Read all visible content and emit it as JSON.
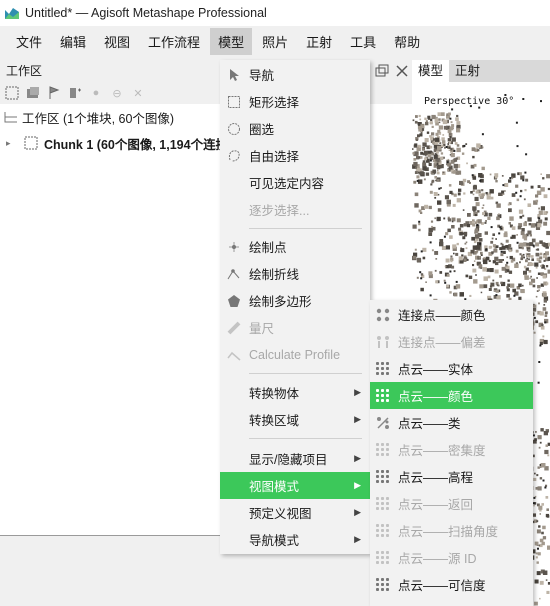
{
  "window": {
    "title": "Untitled* — Agisoft Metashape Professional",
    "accent": "#3cc85a"
  },
  "menubar": [
    "文件",
    "编辑",
    "视图",
    "工作流程",
    "模型",
    "照片",
    "正射",
    "工具",
    "帮助"
  ],
  "workspace": {
    "header": "工作区",
    "root_label": "工作区 (1个堆块, 60个图像)",
    "chunk_label": "Chunk 1 (60个图像, 1,194个连接点)"
  },
  "viewport": {
    "tabs": [
      "模型",
      "正射"
    ],
    "overlay_label": "Perspective 30°"
  },
  "model_menu": [
    {
      "label": "导航",
      "icon": "cursor-arrow-icon",
      "enabled": true
    },
    {
      "label": "矩形选择",
      "icon": "rectangle-select-icon",
      "enabled": true
    },
    {
      "label": "圈选",
      "icon": "circle-select-icon",
      "enabled": true
    },
    {
      "label": "自由选择",
      "icon": "free-select-icon",
      "enabled": true
    },
    {
      "label": "可见选定内容",
      "enabled": true
    },
    {
      "label": "逐步选择...",
      "enabled": false
    },
    {
      "label": "绘制点",
      "icon": "draw-point-icon",
      "enabled": true
    },
    {
      "label": "绘制折线",
      "icon": "draw-polyline-icon",
      "enabled": true
    },
    {
      "label": "绘制多边形",
      "icon": "draw-polygon-icon",
      "enabled": true
    },
    {
      "label": "量尺",
      "icon": "ruler-icon",
      "enabled": false
    },
    {
      "label": "Calculate Profile",
      "icon": "profile-icon",
      "enabled": false
    },
    {
      "label": "转换物体",
      "submenu": true,
      "enabled": true
    },
    {
      "label": "转换区域",
      "submenu": true,
      "enabled": true
    },
    {
      "label": "显示/隐藏项目",
      "submenu": true,
      "enabled": true
    },
    {
      "label": "视图模式",
      "submenu": true,
      "enabled": true,
      "highlighted": true
    },
    {
      "label": "预定义视图",
      "submenu": true,
      "enabled": true
    },
    {
      "label": "导航模式",
      "submenu": true,
      "enabled": true
    }
  ],
  "view_mode_menu": [
    {
      "label": "连接点——颜色",
      "enabled": true
    },
    {
      "label": "连接点——偏差",
      "enabled": false
    },
    {
      "label": "点云——实体",
      "enabled": true
    },
    {
      "label": "点云——颜色",
      "enabled": true,
      "highlighted": true
    },
    {
      "label": "点云——类",
      "enabled": true
    },
    {
      "label": "点云——密集度",
      "enabled": false
    },
    {
      "label": "点云——高程",
      "enabled": true
    },
    {
      "label": "点云——返回",
      "enabled": false
    },
    {
      "label": "点云——扫描角度",
      "enabled": false
    },
    {
      "label": "点云——源 ID",
      "enabled": false
    },
    {
      "label": "点云——可信度",
      "enabled": true
    }
  ]
}
